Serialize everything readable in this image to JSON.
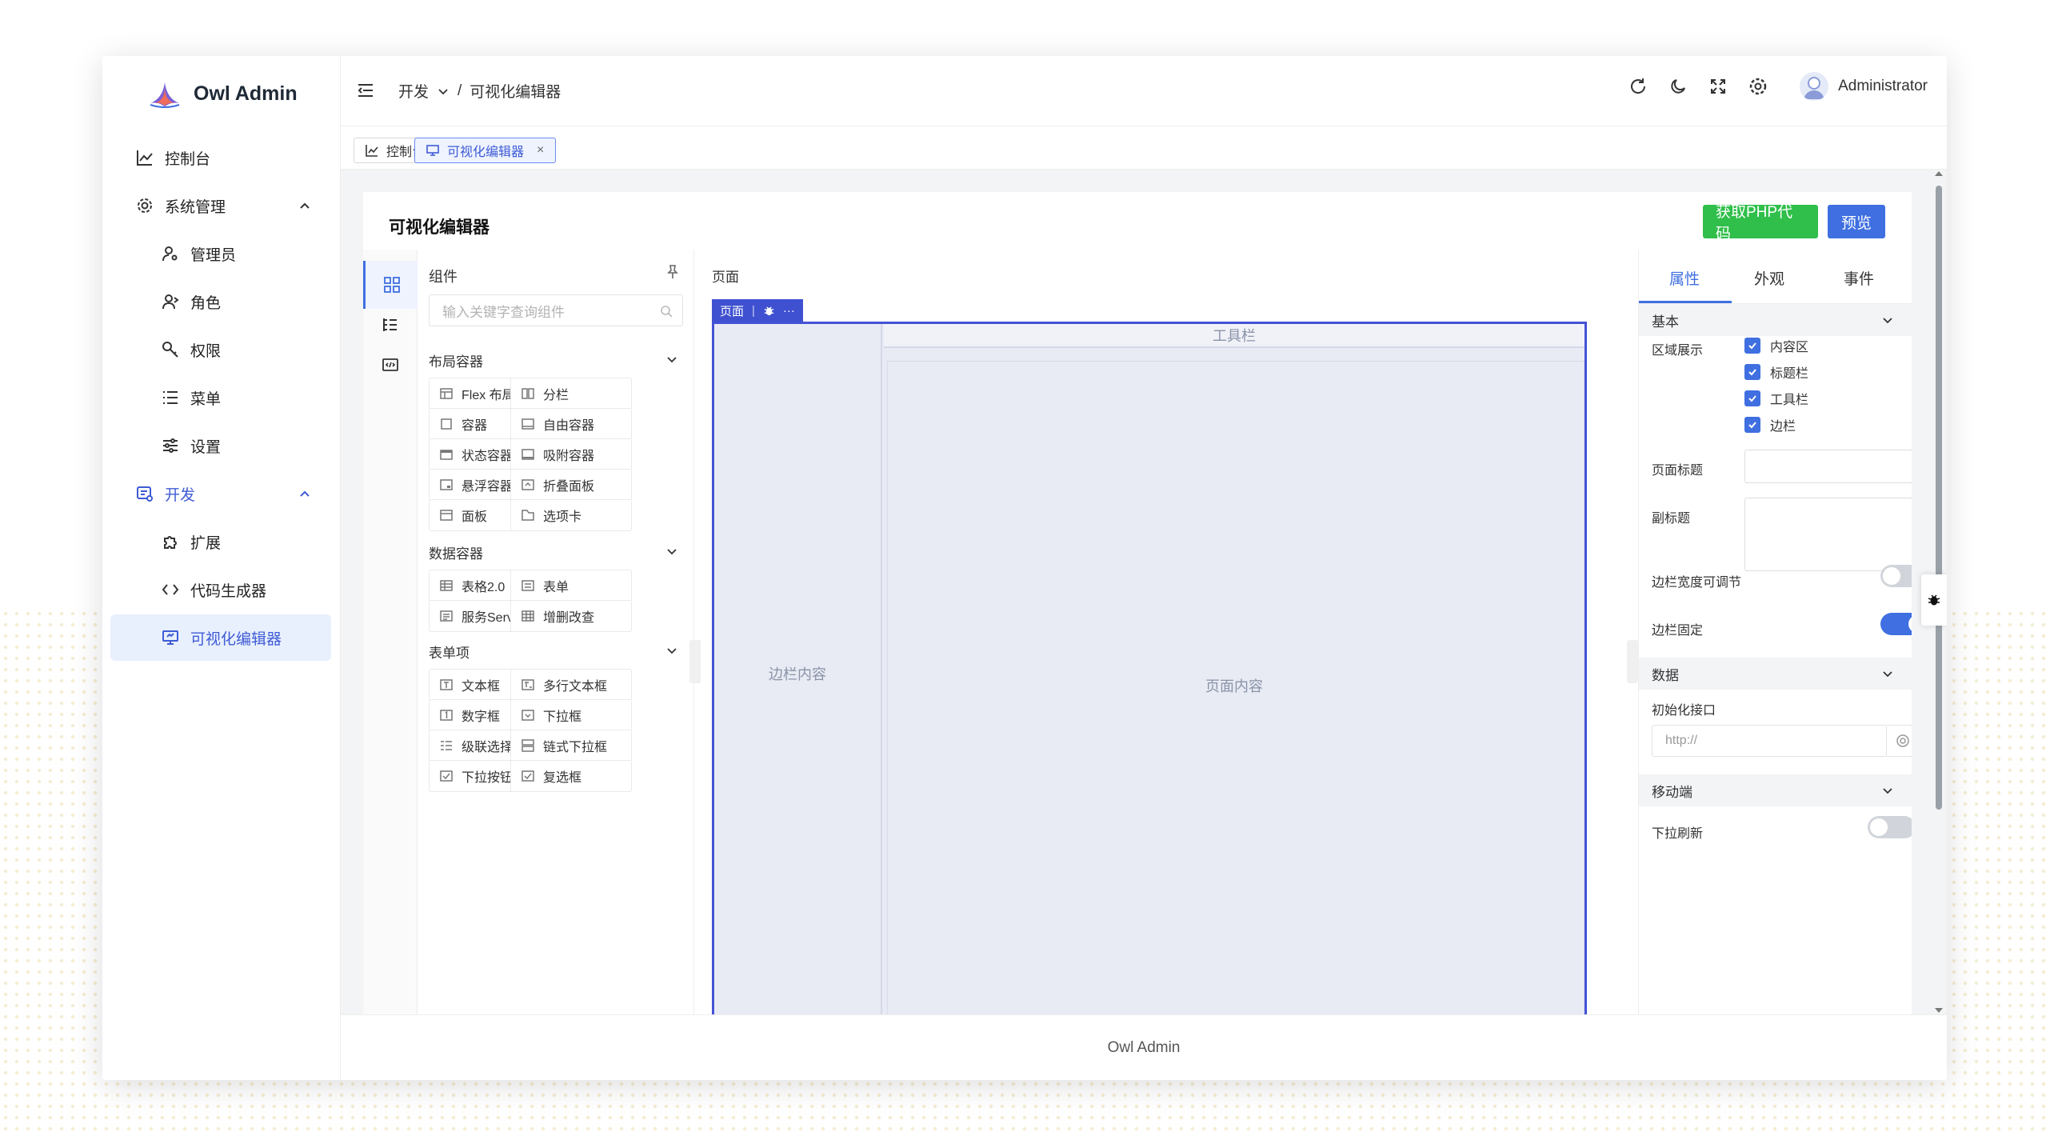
{
  "app": {
    "title": "Owl Admin"
  },
  "sidebar": {
    "items": [
      {
        "label": "控制台"
      },
      {
        "label": "系统管理"
      },
      {
        "label": "管理员"
      },
      {
        "label": "角色"
      },
      {
        "label": "权限"
      },
      {
        "label": "菜单"
      },
      {
        "label": "设置"
      },
      {
        "label": "开发"
      },
      {
        "label": "扩展"
      },
      {
        "label": "代码生成器"
      },
      {
        "label": "可视化编辑器"
      }
    ]
  },
  "header": {
    "breadcrumb": [
      "开发",
      "/",
      "可视化编辑器"
    ],
    "user": "Administrator"
  },
  "tabs": [
    {
      "label": "控制台"
    },
    {
      "label": "可视化编辑器",
      "close": "×"
    }
  ],
  "page": {
    "title": "可视化编辑器",
    "btn_php": "获取PHP代码",
    "btn_preview": "预览"
  },
  "components": {
    "title": "组件",
    "search_placeholder": "输入关键字查询组件",
    "groups": [
      {
        "name": "布局容器",
        "items": [
          "Flex 布局",
          "分栏",
          "容器",
          "自由容器",
          "状态容器",
          "吸附容器",
          "悬浮容器",
          "折叠面板",
          "面板",
          "选项卡"
        ]
      },
      {
        "name": "数据容器",
        "items": [
          "表格2.0",
          "表单",
          "服务Servi...",
          "增删改查"
        ]
      },
      {
        "name": "表单项",
        "items": [
          "文本框",
          "多行文本框",
          "数字框",
          "下拉框",
          "级联选择器",
          "链式下拉框",
          "下拉按钮",
          "复选框"
        ]
      }
    ]
  },
  "canvas": {
    "title": "页面",
    "tag": "页面",
    "tag_sep": "|",
    "tag_more": "···",
    "aside": "边栏内容",
    "toolbar": "工具栏",
    "body": "页面内容"
  },
  "props": {
    "tabs": [
      "属性",
      "外观",
      "事件"
    ],
    "sec_basic": "基本",
    "region_label": "区域展示",
    "regions": [
      "内容区",
      "标题栏",
      "工具栏",
      "边栏"
    ],
    "page_title_label": "页面标题",
    "subtitle_label": "副标题",
    "aside_resize_label": "边栏宽度可调节",
    "aside_fixed_label": "边栏固定",
    "sec_data": "数据",
    "init_api_label": "初始化接口",
    "init_api_placeholder": "http://",
    "sec_mobile": "移动端",
    "pull_refresh_label": "下拉刷新",
    "aside_resize_on": false,
    "aside_fixed_on": true,
    "pull_refresh_on": false
  },
  "footer": {
    "text": "Owl Admin"
  },
  "colors": {
    "accent": "#3f6fe0",
    "green": "#2fbf4a",
    "frame": "#4452d6"
  }
}
